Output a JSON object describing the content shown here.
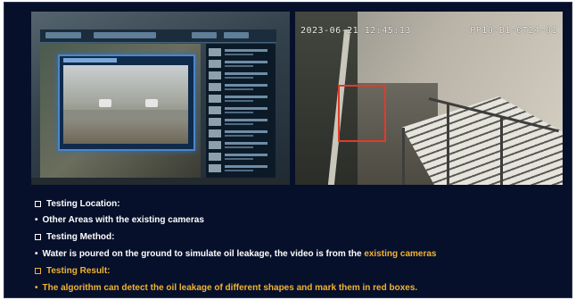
{
  "photos": {
    "right_osd_time": "2023-06-21 12:45:13",
    "right_osd_camera_id": "PP10-B1-0T24-01"
  },
  "bullets": {
    "testing_location_heading": "Testing Location:",
    "testing_location_text": "Other Areas with the existing cameras",
    "testing_method_heading": "Testing Method:",
    "testing_method_text_prefix": "Water is poured on the ground to simulate oil leakage, the video is from the ",
    "testing_method_text_highlight": "existing cameras",
    "testing_result_heading": "Testing Result:",
    "testing_result_text": "The algorithm can detect the oil leakage of different shapes and mark them in red boxes."
  },
  "colors": {
    "background": "#06102a",
    "text": "#ffffff",
    "highlight": "#f2b233",
    "detection_box": "#e23a2a"
  }
}
